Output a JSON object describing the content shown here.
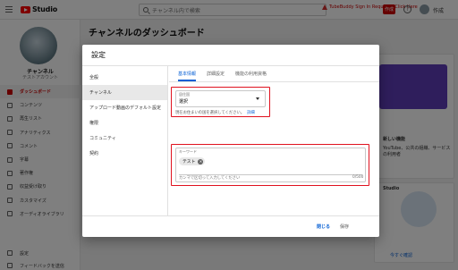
{
  "topbar": {
    "logo_text": "Studio",
    "search_placeholder": "チャンネル内で検索",
    "warning_text": "TubeBuddy Sign In Required. Click Here",
    "record_label": "作成",
    "help_glyph": "?",
    "user_label": "作成"
  },
  "sidebar": {
    "channel_name": "チャンネル",
    "channel_sub": "テストアカウント",
    "items": [
      {
        "label": "ダッシュボード",
        "icon": "dashboard-icon",
        "active": true
      },
      {
        "label": "コンテンツ",
        "icon": "content-icon"
      },
      {
        "label": "再生リスト",
        "icon": "playlist-icon"
      },
      {
        "label": "アナリティクス",
        "icon": "analytics-icon"
      },
      {
        "label": "コメント",
        "icon": "comment-icon"
      },
      {
        "label": "字幕",
        "icon": "subtitles-icon"
      },
      {
        "label": "著作権",
        "icon": "copyright-icon"
      },
      {
        "label": "収益受け取り",
        "icon": "monetization-icon"
      },
      {
        "label": "カスタマイズ",
        "icon": "customize-icon"
      },
      {
        "label": "オーディオライブラリ",
        "icon": "audio-library-icon"
      }
    ],
    "settings_label": "設定",
    "feedback_label": "フィードバックを送信"
  },
  "main": {
    "title": "チャンネルのダッシュボード",
    "card_news_title": "新しい機能",
    "card_news_text": "YouTube、公共の組織、サービスの利用者",
    "card_security_title": "Studio",
    "card_link": "今すぐ確認"
  },
  "dialog": {
    "title": "設定",
    "nav": [
      {
        "label": "全般"
      },
      {
        "label": "チャンネル",
        "active": true
      },
      {
        "label": "アップロード動画のデフォルト設定"
      },
      {
        "label": "権限"
      },
      {
        "label": "コミュニティ"
      },
      {
        "label": "契約"
      }
    ],
    "tabs": [
      {
        "label": "基本情報",
        "active": true
      },
      {
        "label": "詳細設定"
      },
      {
        "label": "機能の利用資格"
      }
    ],
    "country": {
      "label": "居住国",
      "value": "選択",
      "helper": "現在お住まいの国を選択してください。",
      "helper_link": "詳細"
    },
    "keywords": {
      "label": "キーワード",
      "chips": [
        "テスト"
      ],
      "placeholder": "カンマで区切って入力してください",
      "count": "0/500"
    },
    "footer": {
      "close_label": "閉じる",
      "save_label": "保存"
    }
  },
  "colors": {
    "brand_red": "#ff0000",
    "link_blue": "#065fd4",
    "highlight_red": "#e0121f"
  }
}
